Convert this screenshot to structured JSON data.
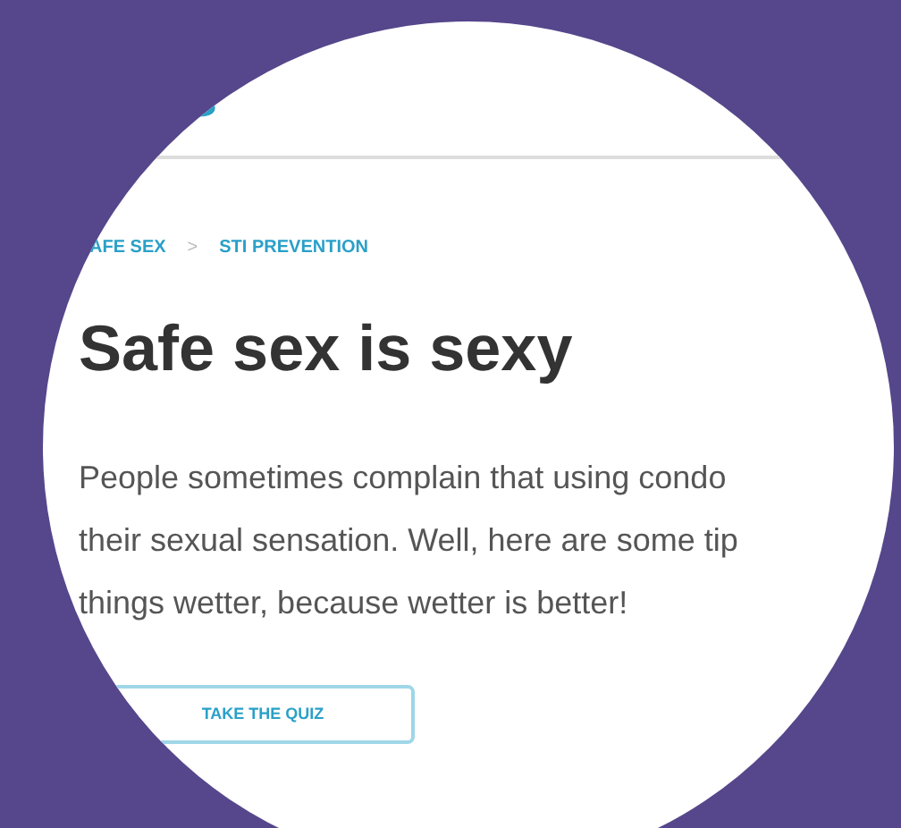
{
  "breadcrumb": [
    {
      "label": "AFE SEX"
    },
    {
      "label": "STI PREVENTION"
    }
  ],
  "breadcrumb_separator": ">",
  "heading": "Safe sex is sexy",
  "paragraph_lines": [
    "People sometimes complain that using condo",
    "their sexual sensation. Well, here are some tip",
    "things wetter, because wetter is better!"
  ],
  "button": "TAKE THE QUIZ"
}
